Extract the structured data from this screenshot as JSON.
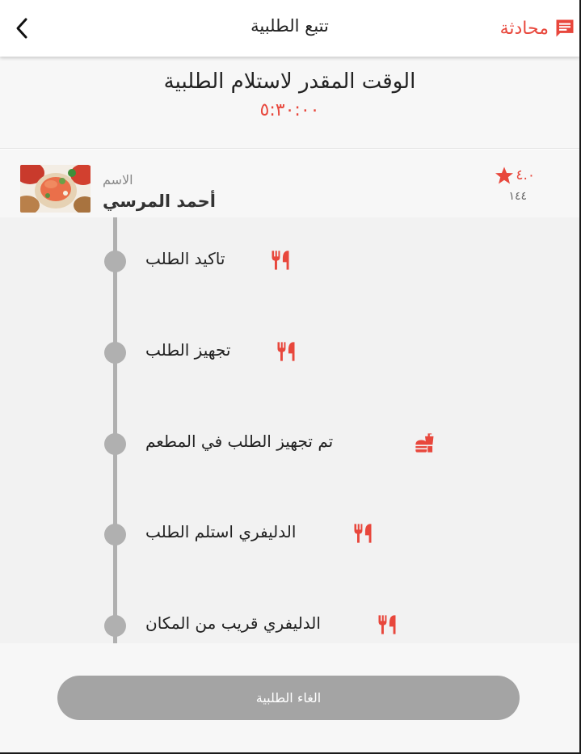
{
  "header": {
    "title": "تتبع الطلبية",
    "chat_label": "محادثة",
    "back_icon": "chevron-left-icon",
    "chat_icon": "chat-icon"
  },
  "eta": {
    "title": "الوقت المقدر لاستلام الطلبية",
    "time": "٥:٣٠:٠٠"
  },
  "driver": {
    "label": "الاسم",
    "name": "أحمد المرسي",
    "rating": "٤.٠",
    "rating_count": "١٤٤"
  },
  "steps": [
    {
      "label": "تاكيد الطلب",
      "icon": "fork-knife-icon"
    },
    {
      "label": "تجهيز الطلب",
      "icon": "fork-knife-icon"
    },
    {
      "label": "تم تجهيز الطلب في المطعم",
      "icon": "fastfood-icon"
    },
    {
      "label": "الدليفري استلم الطلب",
      "icon": "fork-knife-icon"
    },
    {
      "label": "الدليفري قريب من المكان",
      "icon": "fork-knife-icon"
    }
  ],
  "footer": {
    "cancel_label": "الغاء الطلبية"
  },
  "colors": {
    "accent": "#e8473c",
    "timeline_gray": "#b0b0b0",
    "button_gray": "#a4a4a4"
  }
}
